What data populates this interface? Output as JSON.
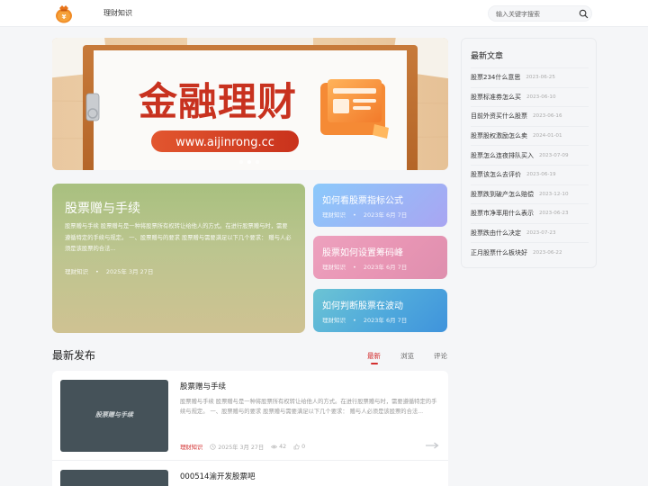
{
  "header": {
    "nav_item": "理财知识",
    "search_placeholder": "输入关键字搜索"
  },
  "banner": {
    "headline": "金融理财",
    "url": "www.aijinrong.cc",
    "slide_count": 3,
    "active_slide": 1
  },
  "featured": {
    "big": {
      "title": "股票赠与手续",
      "desc": "股票赠与手续 股票赠与是一种将股票所有权转让给他人的方式。在进行股票赠与时，需要遵循特定的手续与规定。 一、股票赠与的要求 股票赠与需要满足以下几个要求： 赠与人必须是该股票的合法...",
      "category": "理财知识",
      "date": "2025年 3月 27日"
    },
    "small": [
      {
        "title": "如何看股票指标公式",
        "category": "理财知识",
        "date": "2023年 6月 7日"
      },
      {
        "title": "股票如何设置筹码峰",
        "category": "理财知识",
        "date": "2023年 6月 7日"
      },
      {
        "title": "如何判断股票在波动",
        "category": "理财知识",
        "date": "2023年 6月 7日"
      }
    ]
  },
  "latest": {
    "title": "最新发布",
    "tabs": [
      "最新",
      "浏览",
      "评论"
    ],
    "articles": [
      {
        "thumb_text": "股票赠与手续",
        "title": "股票赠与手续",
        "desc": "股票赠与手续 股票赠与是一种将股票所有权转让给他人的方式。在进行股票赠与时，需要遵循特定的手续与规定。 一、股票赠与的要求 股票赠与需要满足以下几个要求： 赠与人必须是该股票的合法...",
        "category": "理财知识",
        "date": "2025年 3月 27日",
        "views": "42",
        "likes": "0"
      },
      {
        "title": "000514渝开发股票吧"
      }
    ]
  },
  "sidebar": {
    "title": "最新文章",
    "items": [
      {
        "title": "股票234什么意思",
        "date": "2023-06-25"
      },
      {
        "title": "股票标准券怎么买",
        "date": "2023-06-10"
      },
      {
        "title": "目前外资买什么股票",
        "date": "2023-06-16"
      },
      {
        "title": "股票股权激励怎么卖",
        "date": "2024-01-01"
      },
      {
        "title": "股票怎么连夜排队买入",
        "date": "2023-07-09"
      },
      {
        "title": "股票该怎么去评价",
        "date": "2023-06-19"
      },
      {
        "title": "股票跌到破产怎么赔偿",
        "date": "2023-12-10"
      },
      {
        "title": "股票市净率用什么表示",
        "date": "2023-06-23"
      },
      {
        "title": "股票跌由什么决定",
        "date": "2023-07-23"
      },
      {
        "title": "正月股票什么板块好",
        "date": "2023-06-22"
      }
    ]
  },
  "colors": {
    "accent": "#d32f2f",
    "banner_text": "#c8321f",
    "card_big": "#bcc58f",
    "card_blue": "#9bb5f6",
    "card_pink": "#e895b4",
    "card_teal": "#4fa9dc"
  },
  "icons": [
    "money-bag-logo",
    "search-icon",
    "clock-icon",
    "eye-icon",
    "thumb-up-icon",
    "arrow-right-icon"
  ]
}
